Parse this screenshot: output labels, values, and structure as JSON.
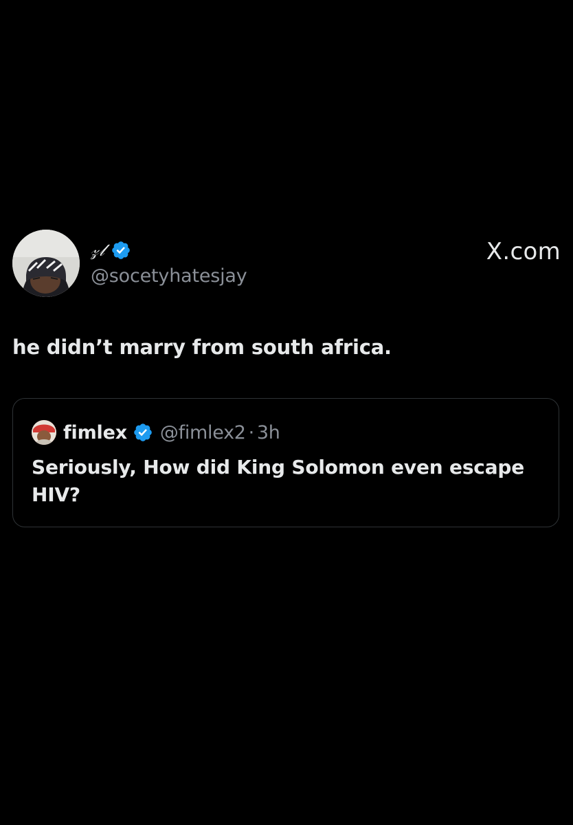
{
  "tweet": {
    "author": {
      "display_name": "𝓏𝓁",
      "handle": "@socetyhatesjay",
      "verified": true,
      "avatar_icon": "user-avatar-photo"
    },
    "text": "he didn’t marry from south africa.",
    "source_brand": "X.com"
  },
  "quoted_tweet": {
    "author": {
      "display_name": "fimlex",
      "handle": "@fimlex2",
      "verified": true,
      "avatar_icon": "user-avatar-photo"
    },
    "separator": "·",
    "time": "3h",
    "text": "Seriously, How did King Solomon even escape HIV?"
  },
  "colors": {
    "background": "#000000",
    "text_primary": "#e7e9ea",
    "text_secondary": "#8b9098",
    "verified_blue": "#1d9bf0",
    "card_border": "#2f3336"
  }
}
